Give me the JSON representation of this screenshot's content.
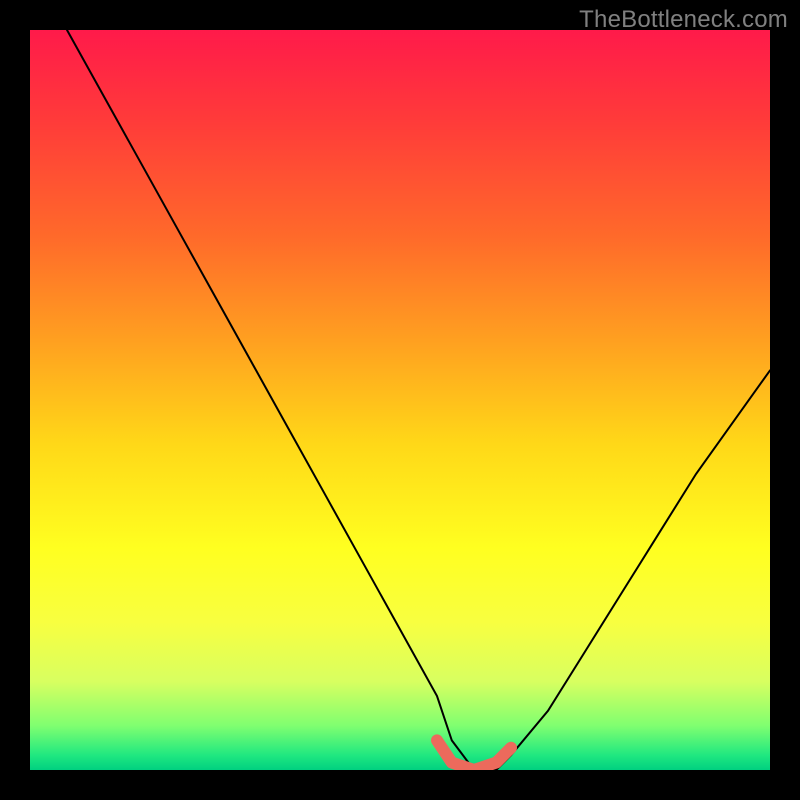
{
  "watermark": "TheBottleneck.com",
  "chart_data": {
    "type": "line",
    "title": "",
    "xlabel": "",
    "ylabel": "",
    "xlim": [
      0,
      100
    ],
    "ylim": [
      0,
      100
    ],
    "grid": false,
    "series": [
      {
        "name": "bottleneck-curve",
        "x": [
          5,
          10,
          15,
          20,
          25,
          30,
          35,
          40,
          45,
          50,
          55,
          57,
          60,
          63,
          65,
          70,
          75,
          80,
          85,
          90,
          95,
          100
        ],
        "y": [
          100,
          91,
          82,
          73,
          64,
          55,
          46,
          37,
          28,
          19,
          10,
          4,
          0,
          0,
          2,
          8,
          16,
          24,
          32,
          40,
          47,
          54
        ],
        "color": "#000000"
      }
    ],
    "annotations": [
      {
        "name": "optimal-zone",
        "x": [
          55,
          57,
          60,
          63,
          65
        ],
        "y": [
          4,
          1,
          0,
          1,
          3
        ],
        "color": "#ec6a5c"
      }
    ],
    "background_gradient": {
      "top": "#ff1a4a",
      "mid": "#ffd818",
      "bottom": "#00d080"
    }
  }
}
